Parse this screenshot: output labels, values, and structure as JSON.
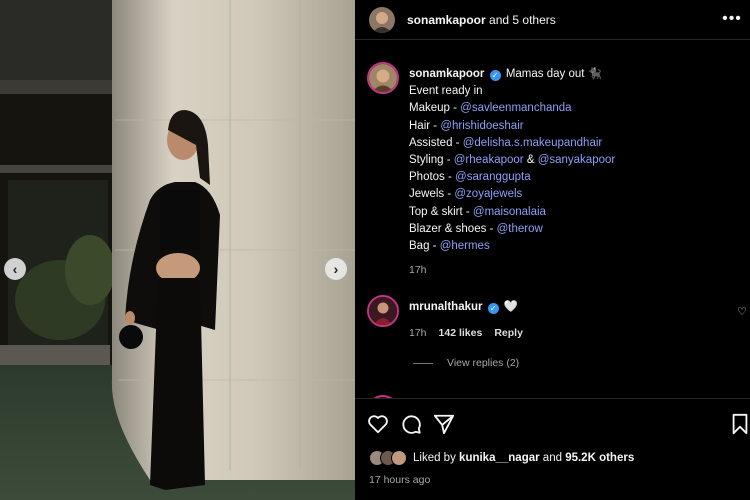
{
  "header": {
    "username": "sonamkapoor",
    "others": "and 5 others"
  },
  "caption": {
    "username": "sonamkapoor",
    "intro": "Mamas day out",
    "lines": [
      {
        "label": "Event ready in",
        "links": []
      },
      {
        "label": "Makeup - ",
        "links": [
          "@savleenmanchanda"
        ]
      },
      {
        "label": "Hair - ",
        "links": [
          "@hrishidoeshair"
        ]
      },
      {
        "label": "Assisted - ",
        "links": [
          "@delisha.s.makeupandhair"
        ]
      },
      {
        "label": "Styling - ",
        "links": [
          "@rheakapoor",
          "@sanyakapoor"
        ]
      },
      {
        "label": "Photos - ",
        "links": [
          "@saranggupta"
        ]
      },
      {
        "label": "Jewels - ",
        "links": [
          "@zoyajewels"
        ]
      },
      {
        "label": "Top & skirt - ",
        "links": [
          "@maisonalaia"
        ]
      },
      {
        "label": "Blazer & shoes - ",
        "links": [
          "@therow"
        ]
      },
      {
        "label": "Bag - ",
        "links": [
          "@hermes"
        ]
      }
    ],
    "and": "&",
    "time": "17h"
  },
  "comment": {
    "username": "mrunalthakur",
    "text": "🤍",
    "time": "17h",
    "likes": "142 likes",
    "reply": "Reply",
    "view_replies": "View replies (2)"
  },
  "likes": {
    "prefix": "Liked by",
    "user": "kunika__nagar",
    "and": "and",
    "count": "95.2K others"
  },
  "posted": "17 hours ago",
  "icons": {
    "prev": "chevron-left-icon",
    "next": "chevron-right-icon",
    "more": "more-horizontal-icon",
    "like": "heart-icon",
    "comment": "comment-icon",
    "share": "send-icon",
    "save": "bookmark-icon"
  },
  "colors": {
    "background": "#000000",
    "link": "#8f9ff8",
    "muted": "#a8a8a8",
    "verified": "#3897f0",
    "story_ring": "#c13584"
  }
}
